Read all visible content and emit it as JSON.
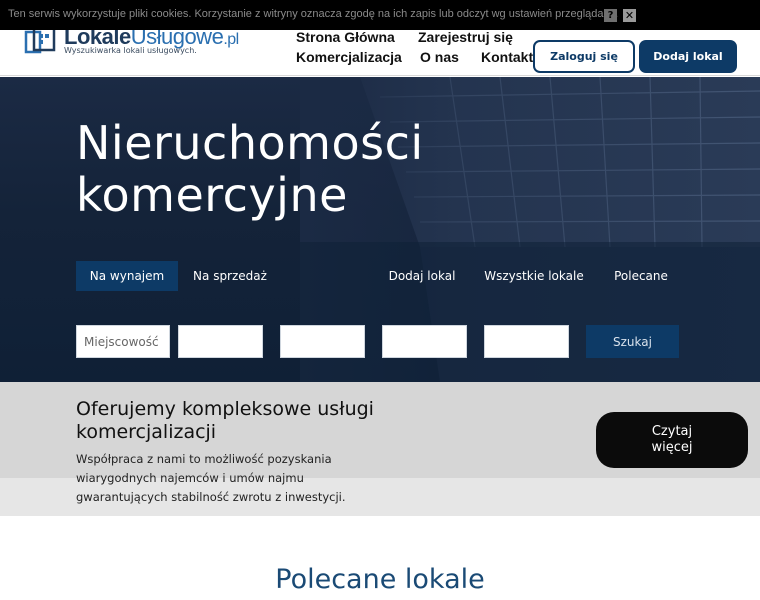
{
  "cookie": {
    "text": "Ten serwis wykorzystuje pliki cookies. Korzystanie z witryny oznacza zgodę na ich zapis lub odczyt wg ustawień przeglądarki.",
    "help_label": "?",
    "close_label": "✕"
  },
  "logo": {
    "brand_main": "Lokale",
    "brand_accent": "Usługowe",
    "brand_tld": ".pl",
    "tagline": "Wyszukiwarka lokali usługowych."
  },
  "nav": {
    "home": "Strona Główna",
    "register": "Zarejestruj się",
    "commercialization": "Komercjalizacja",
    "about": "O nas",
    "contact": "Kontakt"
  },
  "header_buttons": {
    "login": "Zaloguj się",
    "add_listing": "Dodaj lokal"
  },
  "hero": {
    "title_line1": "Nieruchomości",
    "title_line2": "komercyjne",
    "tabs": {
      "rent": "Na wynajem",
      "sale": "Na sprzedaż",
      "add": "Dodaj lokal",
      "all": "Wszystkie lokale",
      "featured": "Polecane"
    },
    "search": {
      "location_value": "Miejscowość",
      "field2_value": "",
      "field3_value": "",
      "field4_value": "",
      "field5_value": "",
      "button": "Szukaj"
    }
  },
  "band": {
    "title": "Oferujemy kompleksowe usługi komercjalizacji",
    "text": "Współpraca z nami to możliwość pozyskania wiarygodnych najemców i umów najmu gwarantujących stabilność zwrotu z inwestycji.",
    "read_more": "Czytaj więcej"
  },
  "featured_title": "Polecane lokale",
  "colors": {
    "brand_navy": "#0d3a66",
    "hero_bg": "#142339",
    "band_bg": "#d6d6d6",
    "section_title": "#1a4a75"
  }
}
